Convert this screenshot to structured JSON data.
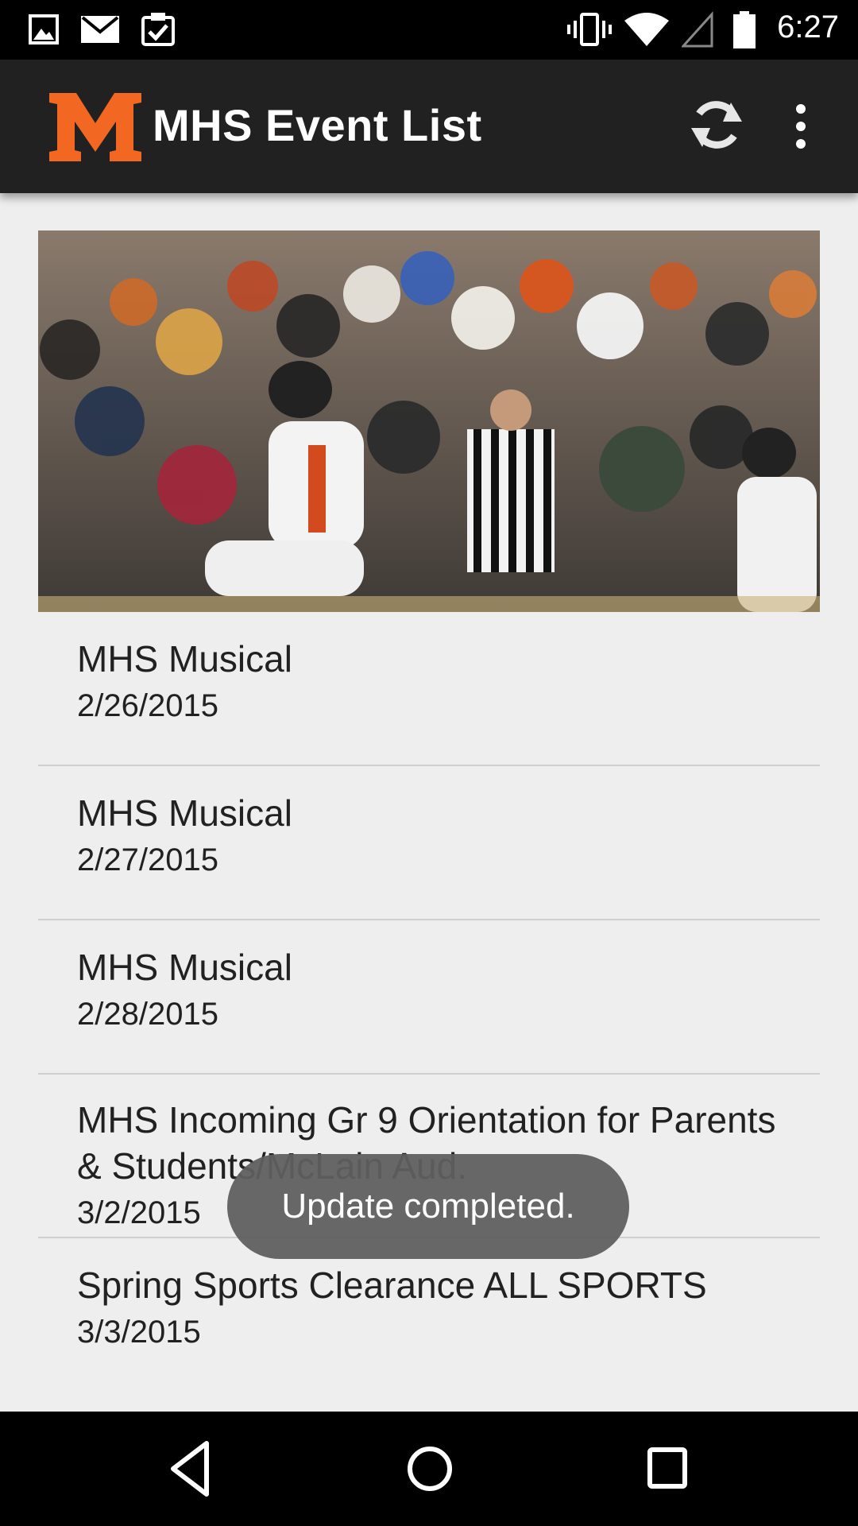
{
  "status_bar": {
    "time": "6:27",
    "left_icons": [
      "image-icon",
      "mail-icon",
      "clipboard-check-icon"
    ],
    "right_icons": [
      "vibrate-icon",
      "wifi-icon",
      "cell-signal-icon",
      "battery-icon"
    ]
  },
  "app_bar": {
    "title": "MHS Event List",
    "logo": "M",
    "actions": [
      "refresh-icon",
      "overflow-menu-icon"
    ]
  },
  "colors": {
    "app_bar": "#212121",
    "logo_orange": "#f26722",
    "background": "#eeeeee",
    "toast": "#5f5f5f"
  },
  "events": [
    {
      "title": "MHS Musical",
      "date": "2/26/2015"
    },
    {
      "title": "MHS Musical",
      "date": "2/27/2015"
    },
    {
      "title": "MHS Musical",
      "date": "2/28/2015"
    },
    {
      "title": "MHS Incoming Gr 9 Orientation for Parents & Students/McLain Aud.",
      "date": "3/2/2015"
    },
    {
      "title": "Spring Sports Clearance ALL SPORTS",
      "date": "3/3/2015"
    }
  ],
  "toast": {
    "message": "Update completed."
  },
  "nav_bar": {
    "buttons": [
      "back-icon",
      "home-icon",
      "recents-icon"
    ]
  }
}
